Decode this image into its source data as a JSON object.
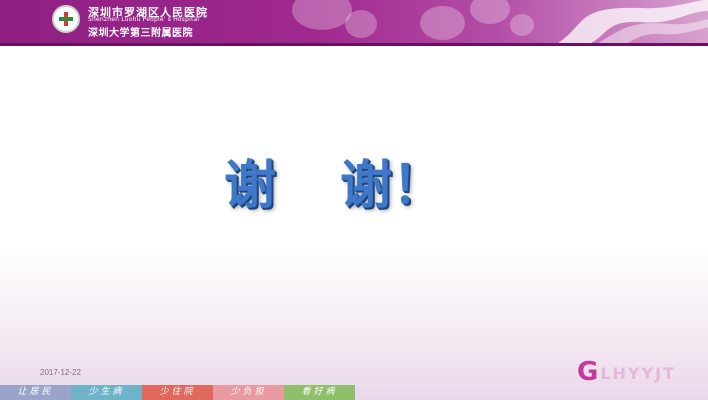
{
  "header": {
    "hospital_name_cn": "深圳市罗湖区人民医院",
    "hospital_name_en": "Shenzhen Luohu People' s Hospital",
    "hospital_affiliate_cn": "深圳大学第三附属医院",
    "colors": {
      "header_bg": "#a0298f",
      "accent": "#c53a98"
    }
  },
  "main": {
    "thanks_part1": "谢",
    "thanks_part2": "谢！",
    "thanks_color": "#3f78c8"
  },
  "footer": {
    "date": "2017-12-22",
    "tabs": [
      {
        "label": "让居民",
        "color": "#9aa3c9"
      },
      {
        "label": "少生病",
        "color": "#6fb3c9"
      },
      {
        "label": "少住院",
        "color": "#e0685d"
      },
      {
        "label": "少负担",
        "color": "#e89aa0"
      },
      {
        "label": "看好病",
        "color": "#8fbf6a"
      }
    ],
    "brand_letter": "G",
    "brand_text": "LHYYJT"
  },
  "icons": [
    "hospital-logo-icon",
    "header-swoosh-decoration"
  ]
}
